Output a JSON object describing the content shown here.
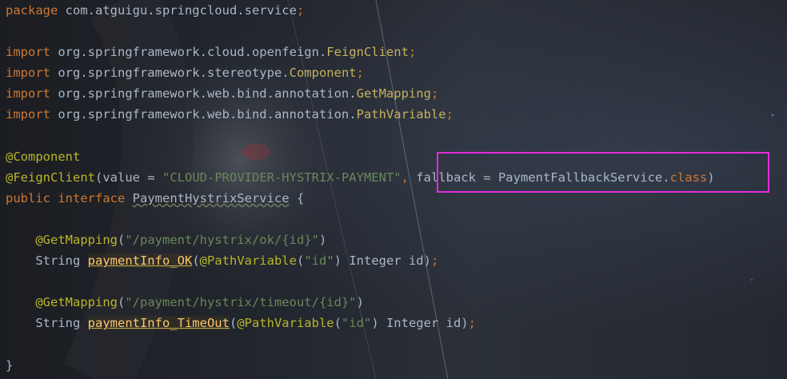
{
  "editor": {
    "lines": [
      {
        "tokens": [
          {
            "t": "package ",
            "c": "kw"
          },
          {
            "t": "com.atguigu.springcloud.service",
            "c": "plain"
          },
          {
            "t": ";",
            "c": "punc"
          }
        ]
      },
      {
        "tokens": []
      },
      {
        "tokens": [
          {
            "t": "import ",
            "c": "kw"
          },
          {
            "t": "org.springframework.cloud.openfeign.",
            "c": "plain"
          },
          {
            "t": "FeignClient",
            "c": "cls"
          },
          {
            "t": ";",
            "c": "punc"
          }
        ]
      },
      {
        "tokens": [
          {
            "t": "import ",
            "c": "kw"
          },
          {
            "t": "org.springframework.stereotype.",
            "c": "plain"
          },
          {
            "t": "Component",
            "c": "cls"
          },
          {
            "t": ";",
            "c": "punc"
          }
        ]
      },
      {
        "tokens": [
          {
            "t": "import ",
            "c": "kw"
          },
          {
            "t": "org.springframework.web.bind.annotation.",
            "c": "plain"
          },
          {
            "t": "GetMapping",
            "c": "cls"
          },
          {
            "t": ";",
            "c": "punc"
          }
        ]
      },
      {
        "tokens": [
          {
            "t": "import ",
            "c": "kw"
          },
          {
            "t": "org.springframework.web.bind.annotation.",
            "c": "plain"
          },
          {
            "t": "PathVariable",
            "c": "cls"
          },
          {
            "t": ";",
            "c": "punc"
          }
        ]
      },
      {
        "tokens": []
      },
      {
        "tokens": [
          {
            "t": "@Component",
            "c": "ann"
          }
        ]
      },
      {
        "tokens": [
          {
            "t": "@FeignClient",
            "c": "ann"
          },
          {
            "t": "(",
            "c": "plain"
          },
          {
            "t": "value",
            "c": "plain"
          },
          {
            "t": " = ",
            "c": "plain"
          },
          {
            "t": "\"CLOUD-PROVIDER-HYSTRIX-PAYMENT\"",
            "c": "str"
          },
          {
            "t": ", ",
            "c": "punc"
          },
          {
            "t": "fallback",
            "c": "plain"
          },
          {
            "t": " = PaymentFallbackService.",
            "c": "plain"
          },
          {
            "t": "class",
            "c": "kw"
          },
          {
            "t": ")",
            "c": "plain"
          }
        ]
      },
      {
        "tokens": [
          {
            "t": "public ",
            "c": "kw"
          },
          {
            "t": "interface ",
            "c": "kw"
          },
          {
            "t": "PaymentHystrixService",
            "c": "iface"
          },
          {
            "t": " {",
            "c": "plain"
          }
        ]
      },
      {
        "tokens": []
      },
      {
        "tokens": [
          {
            "t": "    ",
            "c": "plain"
          },
          {
            "t": "@GetMapping",
            "c": "ann"
          },
          {
            "t": "(",
            "c": "plain"
          },
          {
            "t": "\"/payment/hystrix/ok/{id}\"",
            "c": "str"
          },
          {
            "t": ")",
            "c": "plain"
          }
        ]
      },
      {
        "tokens": [
          {
            "t": "    String ",
            "c": "plain"
          },
          {
            "t": "paymentInfo_OK",
            "c": "method"
          },
          {
            "t": "(",
            "c": "plain"
          },
          {
            "t": "@PathVariable",
            "c": "ann"
          },
          {
            "t": "(",
            "c": "plain"
          },
          {
            "t": "\"id\"",
            "c": "str"
          },
          {
            "t": ") Integer id)",
            "c": "plain"
          },
          {
            "t": ";",
            "c": "punc"
          }
        ]
      },
      {
        "tokens": []
      },
      {
        "tokens": [
          {
            "t": "    ",
            "c": "plain"
          },
          {
            "t": "@GetMapping",
            "c": "ann"
          },
          {
            "t": "(",
            "c": "plain"
          },
          {
            "t": "\"/payment/hystrix/timeout/{id}\"",
            "c": "str"
          },
          {
            "t": ")",
            "c": "plain"
          }
        ]
      },
      {
        "tokens": [
          {
            "t": "    String ",
            "c": "plain"
          },
          {
            "t": "paymentInfo_TimeOut",
            "c": "method"
          },
          {
            "t": "(",
            "c": "plain"
          },
          {
            "t": "@PathVariable",
            "c": "ann"
          },
          {
            "t": "(",
            "c": "plain"
          },
          {
            "t": "\"id\"",
            "c": "str"
          },
          {
            "t": ") Integer id)",
            "c": "plain"
          },
          {
            "t": ";",
            "c": "punc"
          }
        ]
      },
      {
        "tokens": []
      },
      {
        "tokens": [
          {
            "t": "}",
            "c": "plain"
          }
        ]
      }
    ]
  },
  "annotation": {
    "box_color": "#e62be0"
  }
}
